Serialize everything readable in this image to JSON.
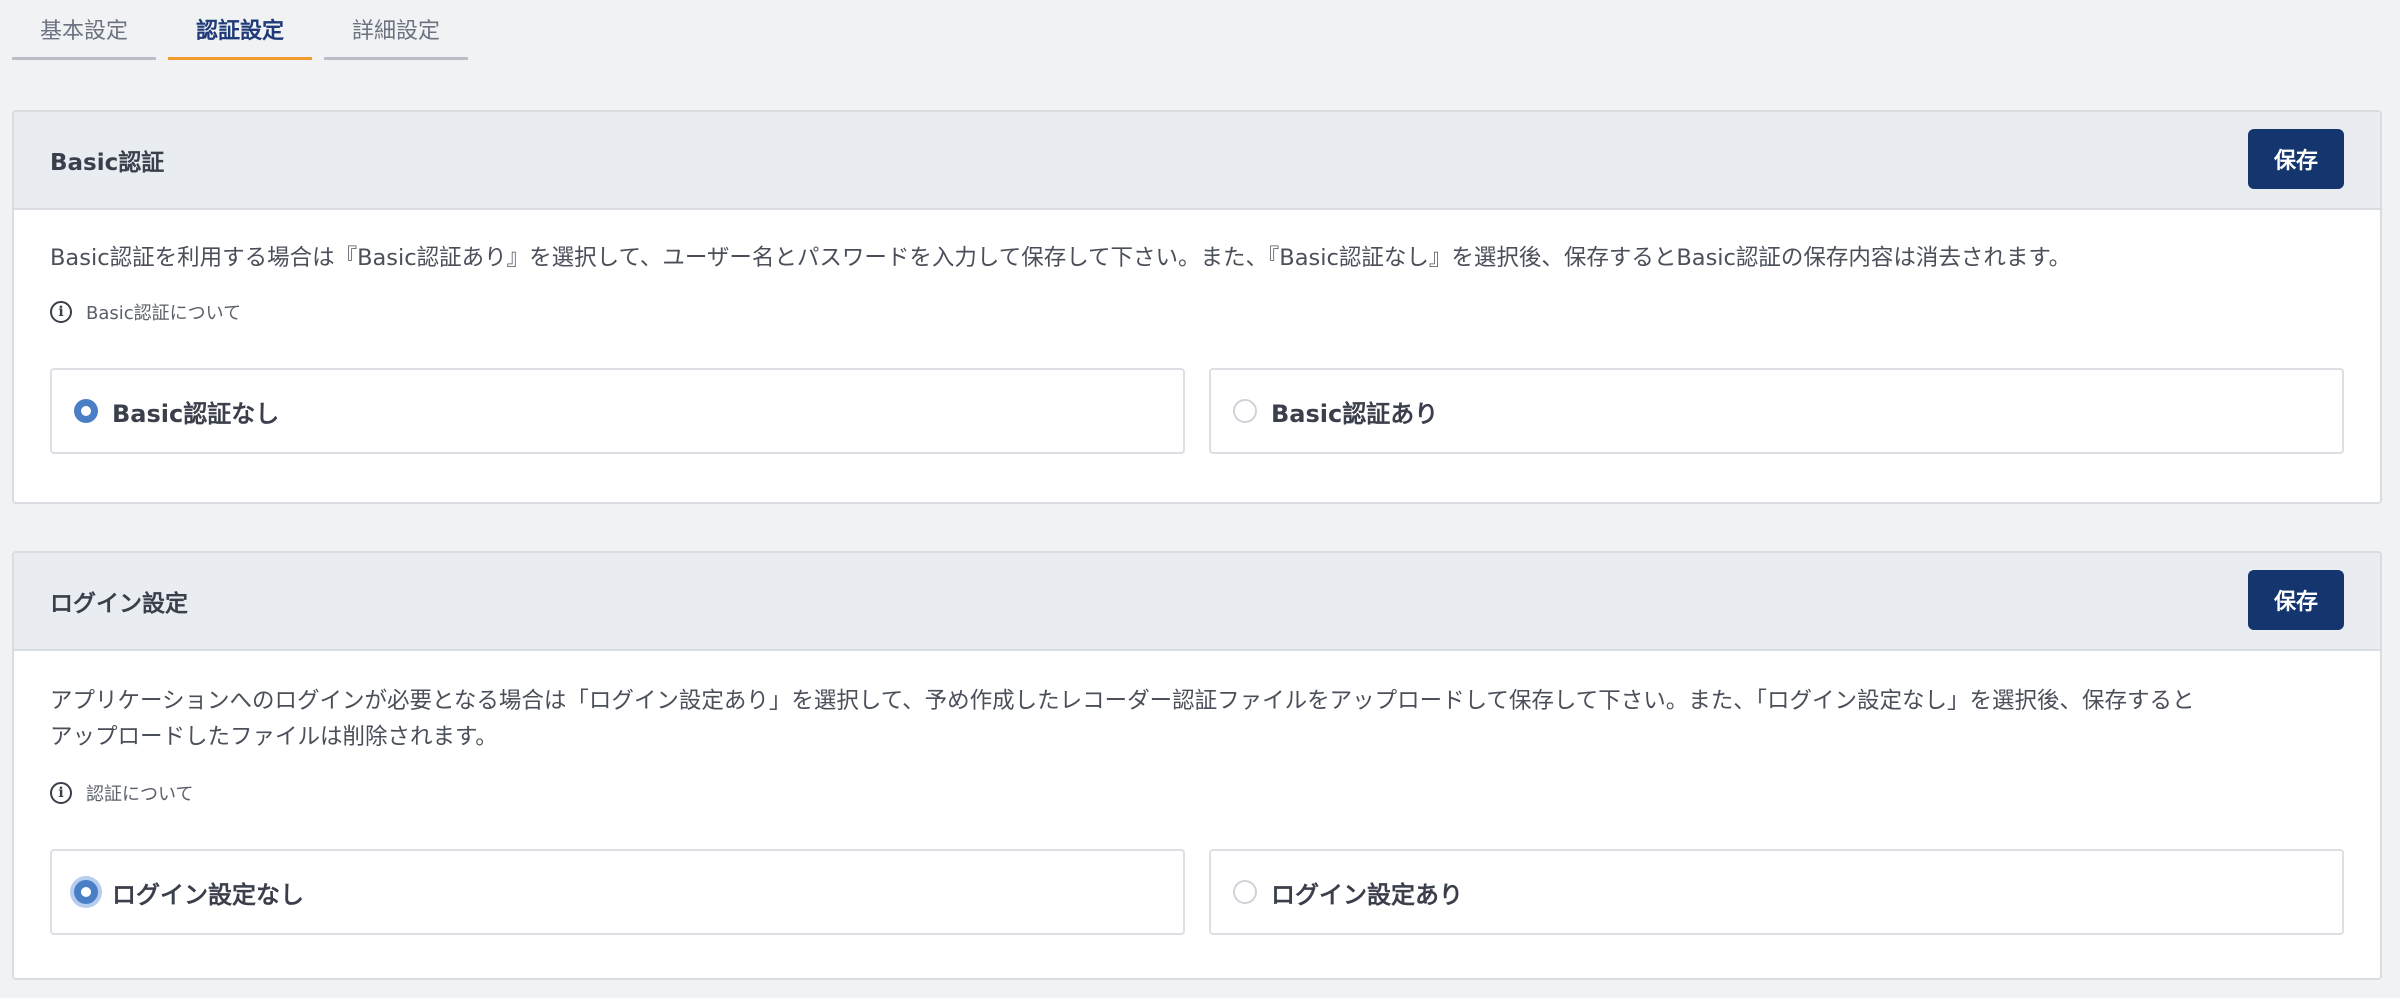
{
  "tabs": [
    {
      "label": "基本設定",
      "active": false
    },
    {
      "label": "認証設定",
      "active": true
    },
    {
      "label": "詳細設定",
      "active": false
    }
  ],
  "basic_auth": {
    "title": "Basic認証",
    "save_label": "保存",
    "description": "Basic認証を利用する場合は『Basic認証あり』を選択して、ユーザー名とパスワードを入力して保存して下さい。また、『Basic認証なし』を選択後、保存するとBasic認証の保存内容は消去されます。",
    "info_link": "Basic認証について",
    "options": [
      {
        "label": "Basic認証なし",
        "checked": true
      },
      {
        "label": "Basic認証あり",
        "checked": false
      }
    ]
  },
  "login": {
    "title": "ログイン設定",
    "save_label": "保存",
    "description": "アプリケーションへのログインが必要となる場合は「ログイン設定あり」を選択して、予め作成したレコーダー認証ファイルをアップロードして保存して下さい。また、「ログイン設定なし」を選択後、保存すると\nアップロードしたファイルは削除されます。",
    "info_link": "認証について",
    "options": [
      {
        "label": "ログイン設定なし",
        "checked": true
      },
      {
        "label": "ログイン設定あり",
        "checked": false
      }
    ]
  },
  "colors": {
    "primary": "#15356f",
    "tab_active_underline": "#f29a2e",
    "radio_checked": "#4a7fc6",
    "header_bg": "#e9ecf1",
    "page_bg": "#f1f2f4"
  },
  "icons": {
    "info": "info-circle-icon"
  }
}
